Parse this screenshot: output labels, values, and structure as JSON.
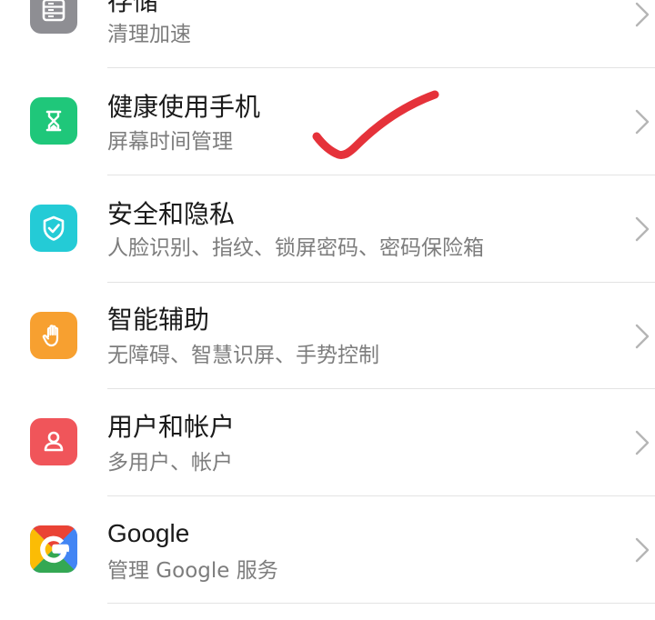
{
  "settings": {
    "items": [
      {
        "title": "存储",
        "subtitle": "清理加速",
        "icon": "storage-icon",
        "color": "#8e8e93"
      },
      {
        "title": "健康使用手机",
        "subtitle": "屏幕时间管理",
        "icon": "hourglass-icon",
        "color": "#1fc77a"
      },
      {
        "title": "安全和隐私",
        "subtitle": "人脸识别、指纹、锁屏密码、密码保险箱",
        "icon": "shield-check-icon",
        "color": "#24cbd6"
      },
      {
        "title": "智能辅助",
        "subtitle": "无障碍、智慧识屏、手势控制",
        "icon": "hand-icon",
        "color": "#f7a030"
      },
      {
        "title": "用户和帐户",
        "subtitle": "多用户、帐户",
        "icon": "user-icon",
        "color": "#f0555a"
      },
      {
        "title": "Google",
        "subtitle": "管理 Google 服务",
        "icon": "google-icon",
        "color": "#4285f4"
      }
    ]
  },
  "annotation": {
    "icon": "red-checkmark-annotation",
    "color": "#e5323a"
  }
}
